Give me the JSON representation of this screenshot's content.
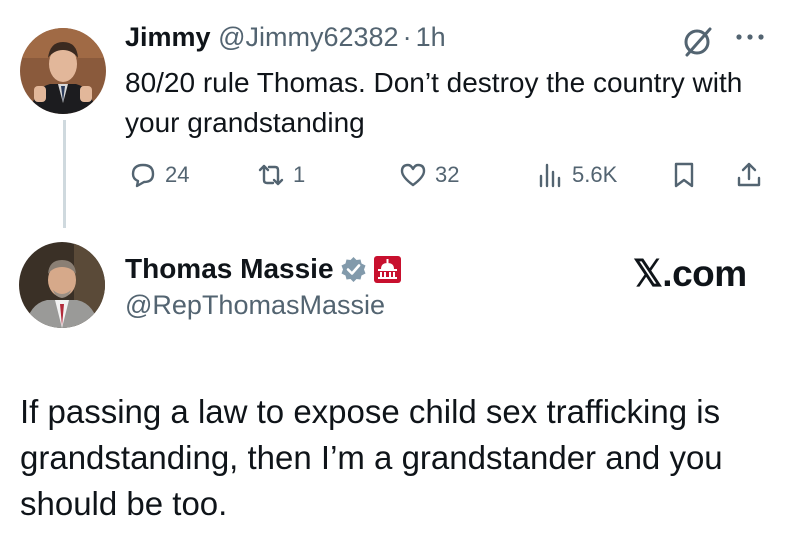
{
  "reply": {
    "name": "Jimmy",
    "handle": "@Jimmy62382",
    "separator": "·",
    "time": "1h",
    "text": "80/20 rule Thomas. Don’t destroy the country with your grandstanding",
    "stats": {
      "replies": "24",
      "reposts": "1",
      "likes": "32",
      "views": "5.6K"
    }
  },
  "main": {
    "name": "Thomas Massie",
    "handle": "@RepThomasMassie",
    "brand": "𝕏.com",
    "text": "If passing a law to expose child sex trafficking is grandstanding, then I’m a grandstander and you should be too."
  },
  "colors": {
    "text": "#0f1419",
    "secondary": "#536471",
    "thread_line": "#cfd9de",
    "verified_badge": "#829aab",
    "gov_badge": "#c8102e"
  },
  "icons": {
    "grok": "grok-icon",
    "more": "more-icon",
    "reply": "reply-icon",
    "repost": "repost-icon",
    "like": "heart-icon",
    "views": "views-icon",
    "bookmark": "bookmark-icon",
    "share": "share-icon",
    "verified": "verified-badge-icon",
    "government": "capitol-badge-icon"
  }
}
